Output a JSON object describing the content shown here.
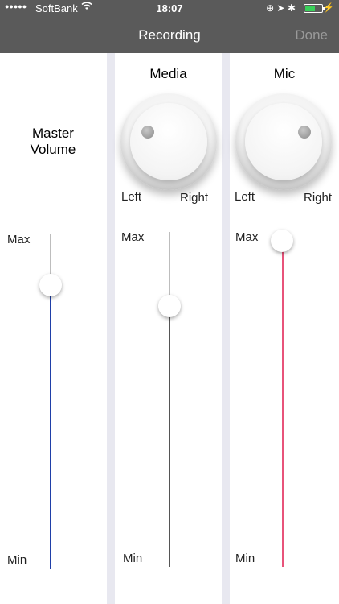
{
  "status_bar": {
    "signal_dots": "●●●●●",
    "carrier": "SoftBank",
    "time": "18:07"
  },
  "nav": {
    "title": "Recording",
    "done_label": "Done"
  },
  "master": {
    "title": "Master Volume",
    "max_label": "Max",
    "min_label": "Min",
    "level": 0.82,
    "color": "#1f3fa8"
  },
  "media": {
    "title": "Media",
    "left_label": "Left",
    "right_label": "Right",
    "max_label": "Max",
    "min_label": "Min",
    "level": 0.77,
    "color": "#555555"
  },
  "mic": {
    "title": "Mic",
    "left_label": "Left",
    "right_label": "Right",
    "max_label": "Max",
    "min_label": "Min",
    "level": 1.0,
    "color": "#e8537a"
  },
  "colors": {
    "navbar": "#5a5a5a",
    "divider": "#e8e8f0",
    "battery": "#39d05a"
  }
}
